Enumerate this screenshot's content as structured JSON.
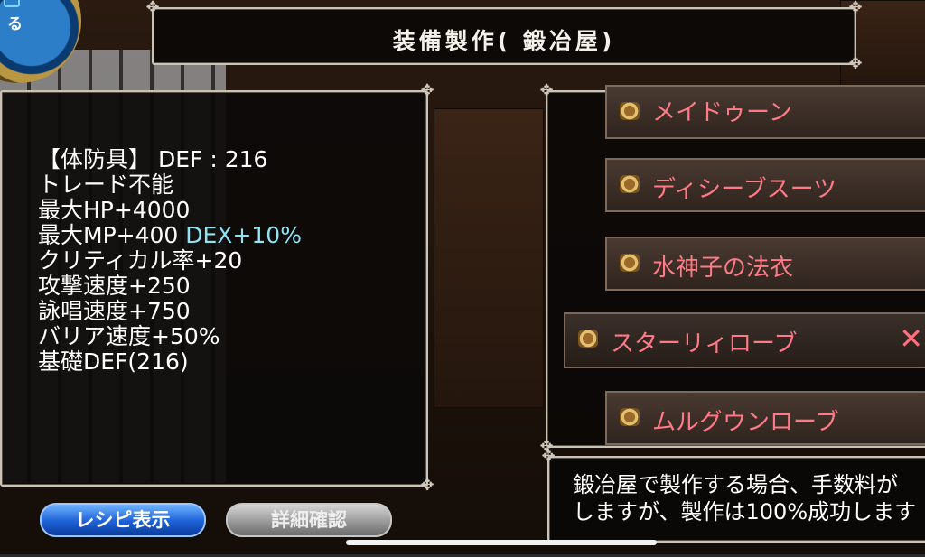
{
  "title": "装備製作( 鍛冶屋)",
  "back_button": {
    "label": "る"
  },
  "stats": [
    {
      "text": "【体防具】 DEF : 216",
      "extra": ""
    },
    {
      "text": "トレード不能",
      "extra": ""
    },
    {
      "text": "最大HP+4000",
      "extra": ""
    },
    {
      "text": "最大MP+400",
      "extra": "DEX+10%"
    },
    {
      "text": "クリティカル率+20",
      "extra": ""
    },
    {
      "text": "攻撃速度+250",
      "extra": ""
    },
    {
      "text": "詠唱速度+750",
      "extra": ""
    },
    {
      "text": "バリア速度+50%",
      "extra": ""
    },
    {
      "text": "基礎DEF(216)",
      "extra": ""
    }
  ],
  "buttons": {
    "recipe": "レシピ表示",
    "detail": "詳細確認"
  },
  "recipes": [
    {
      "label": "メイドゥーン",
      "selected": false
    },
    {
      "label": "ディシーブスーツ",
      "selected": false
    },
    {
      "label": "水神子の法衣",
      "selected": false
    },
    {
      "label": "スターリィローブ",
      "selected": true
    },
    {
      "label": "ムルグウンローブ",
      "selected": false
    }
  ],
  "remove_symbol": "✕",
  "description": [
    "鍛冶屋で製作する場合、手数料が",
    "しますが、製作は100%成功します"
  ],
  "colors": {
    "recipe_text": "#ff7a86",
    "stat_extra": "#8fe3f2",
    "recipe_button": "#1d60d6"
  }
}
